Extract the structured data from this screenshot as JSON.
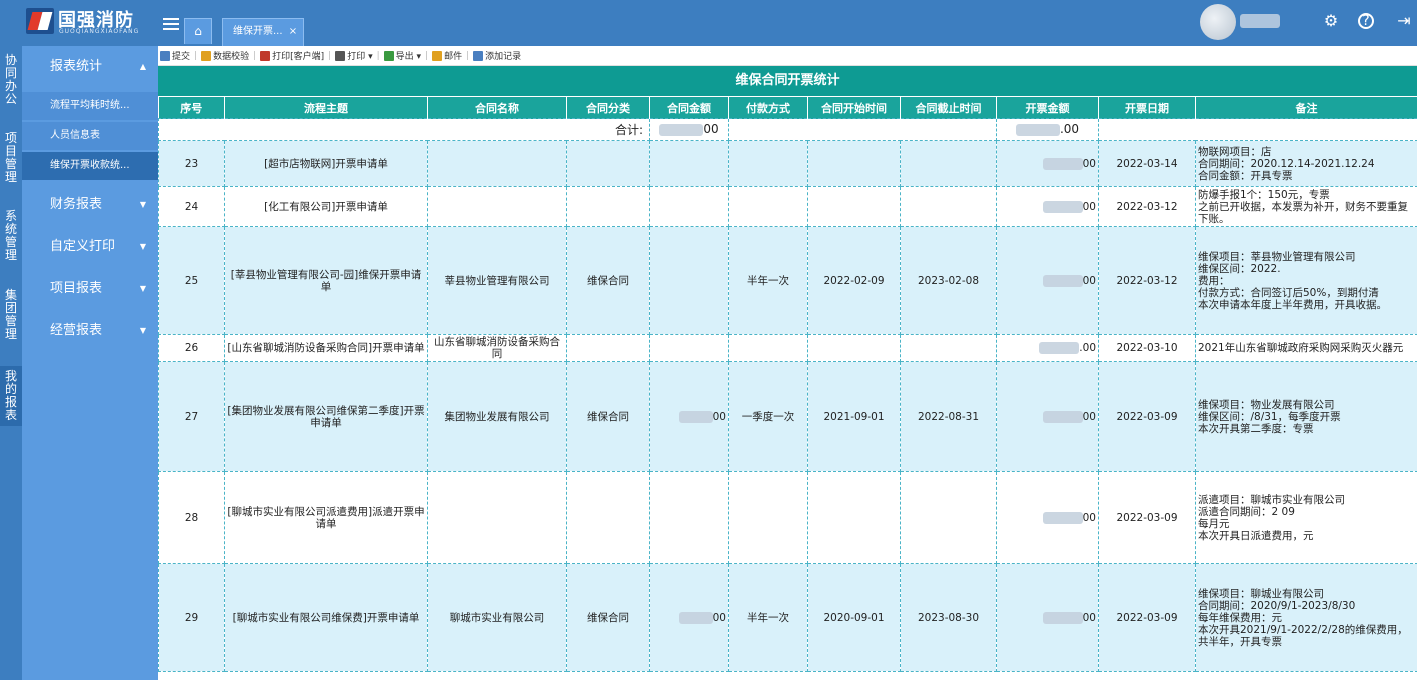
{
  "brand": {
    "name_cn": "国强消防",
    "name_en": "GUOQIANGXIAOFANG"
  },
  "header": {
    "home_label": "⌂",
    "active_tab": "维保开票...",
    "tab_close": "×"
  },
  "vnav": [
    {
      "label": "协同办公",
      "active": false
    },
    {
      "label": "项目管理",
      "active": false
    },
    {
      "label": "系统管理",
      "active": false
    },
    {
      "label": "集团管理",
      "active": false
    },
    {
      "label": "我的报表",
      "active": true
    }
  ],
  "sidebar": {
    "heads": [
      {
        "label": "报表统计",
        "arrow": "▲"
      },
      {
        "label": "财务报表",
        "arrow": "▼"
      },
      {
        "label": "自定义打印",
        "arrow": "▼"
      },
      {
        "label": "项目报表",
        "arrow": "▼"
      },
      {
        "label": "经营报表",
        "arrow": "▼"
      }
    ],
    "subs": [
      {
        "label": "流程平均耗时统...",
        "active": false
      },
      {
        "label": "人员信息表",
        "active": false
      },
      {
        "label": "维保开票收款统...",
        "active": true
      }
    ]
  },
  "toolbar": [
    {
      "label": "提交",
      "icon": "submit-icon",
      "color": "#4a7fc0"
    },
    {
      "label": "数据校验",
      "icon": "check-icon",
      "color": "#e0a020"
    },
    {
      "label": "打印[客户端]",
      "icon": "print-client-icon",
      "color": "#c0392b"
    },
    {
      "label": "打印 ▾",
      "icon": "print-icon",
      "color": "#555555"
    },
    {
      "label": "导出 ▾",
      "icon": "export-icon",
      "color": "#3a9a40"
    },
    {
      "label": "邮件",
      "icon": "mail-icon",
      "color": "#e0a020"
    },
    {
      "label": "添加记录",
      "icon": "add-record-icon",
      "color": "#4a7fc0"
    }
  ],
  "report": {
    "title": "维保合同开票统计",
    "columns": [
      "序号",
      "流程主题",
      "合同名称",
      "合同分类",
      "合同金额",
      "付款方式",
      "合同开始时间",
      "合同截止时间",
      "开票金额",
      "开票日期",
      "备注"
    ],
    "total_label": "合计:",
    "total_contract_amount": "00",
    "total_invoice_amount": ".00",
    "rows": [
      {
        "no": "23",
        "topic": "[超市店物联网]开票申请单",
        "contract": "",
        "category": "",
        "amount": "",
        "pay": "",
        "start": "",
        "end": "",
        "invoice": "00",
        "date": "2022-03-14",
        "note": "物联网项目：店\n合同期间：2020.12.14-2021.12.24\n合同金额：开具专票"
      },
      {
        "no": "24",
        "topic": "[化工有限公司]开票申请单",
        "contract": "",
        "category": "",
        "amount": "",
        "pay": "",
        "start": "",
        "end": "",
        "invoice": "00",
        "date": "2022-03-12",
        "note": "防爆手报1个：150元，专票\n之前已开收据，本发票为补开，财务不要重复下账。"
      },
      {
        "no": "25",
        "topic": "[莘县物业管理有限公司-园]维保开票申请单",
        "contract": "莘县物业管理有限公司",
        "category": "维保合同",
        "amount": "",
        "pay": "半年一次",
        "start": "2022-02-09",
        "end": "2023-02-08",
        "invoice": "00",
        "date": "2022-03-12",
        "note": "维保项目：莘县物业管理有限公司\n维保区间：2022.\n费用：\n付款方式：合同签订后50%，到期付清\n本次申请本年度上半年费用，开具收据。"
      },
      {
        "no": "26",
        "topic": "[山东省聊城消防设备采购合同]开票申请单",
        "contract": "山东省聊城消防设备采购合同",
        "category": "",
        "amount": "",
        "pay": "",
        "start": "",
        "end": "",
        "invoice": ".00",
        "date": "2022-03-10",
        "note": "2021年山东省聊城政府采购网采购灭火器元"
      },
      {
        "no": "27",
        "topic": "[集团物业发展有限公司维保第二季度]开票申请单",
        "contract": "集团物业发展有限公司",
        "category": "维保合同",
        "amount": "00",
        "pay": "一季度一次",
        "start": "2021-09-01",
        "end": "2022-08-31",
        "invoice": "00",
        "date": "2022-03-09",
        "note": "维保项目：物业发展有限公司\n维保区间：/8/31，每季度开票\n本次开具第二季度：专票"
      },
      {
        "no": "28",
        "topic": "[聊城市实业有限公司派遣费用]派遣开票申请单",
        "contract": "",
        "category": "",
        "amount": "",
        "pay": "",
        "start": "",
        "end": "",
        "invoice": "00",
        "date": "2022-03-09",
        "note": "派遣项目：聊城市实业有限公司\n派遣合同期间：2 09\n每月元\n本次开具日派遣费用，元"
      },
      {
        "no": "29",
        "topic": "[聊城市实业有限公司维保费]开票申请单",
        "contract": "聊城市实业有限公司",
        "category": "维保合同",
        "amount": "00",
        "pay": "半年一次",
        "start": "2020-09-01",
        "end": "2023-08-30",
        "invoice": "00",
        "date": "2022-03-09",
        "note": "维保项目：聊城业有限公司\n合同期间：2020/9/1-2023/8/30\n每年维保费用：元\n本次开具2021/9/1-2022/2/28的维保费用，共半年，开具专票"
      }
    ]
  }
}
